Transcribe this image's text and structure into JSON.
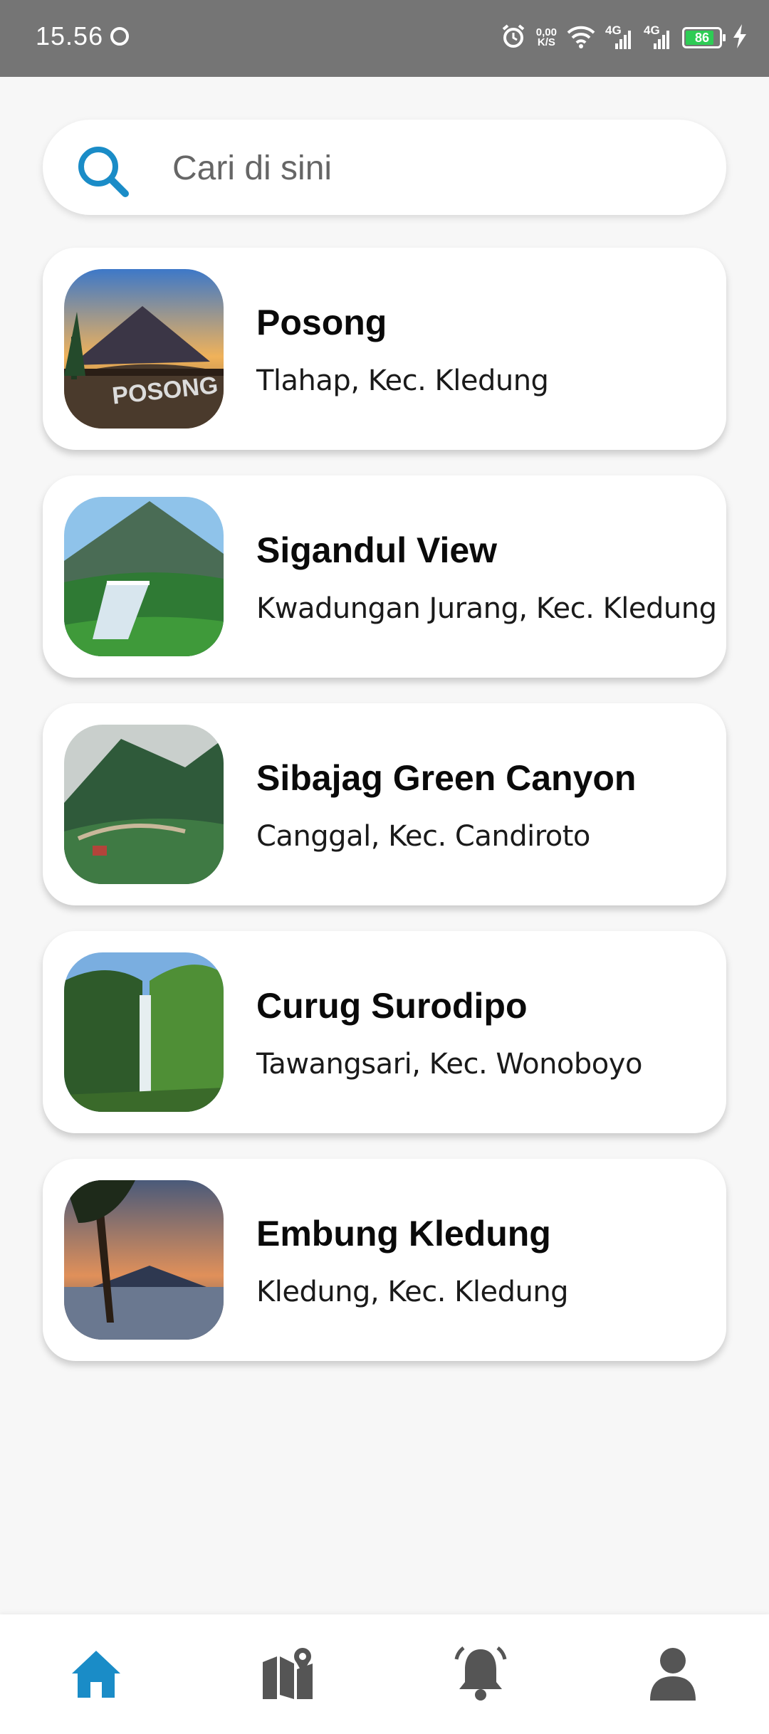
{
  "status_bar": {
    "time": "15.56",
    "net_speed_value": "0,00",
    "net_speed_unit": "K/S",
    "sim1": "4G",
    "sim2": "4G",
    "battery": "86",
    "battery_level": 0.86
  },
  "search": {
    "placeholder": "Cari di sini",
    "value": ""
  },
  "places": [
    {
      "name": "Posong",
      "location": "Tlahap, Kec. Kledung",
      "thumb_label": "POSONG"
    },
    {
      "name": "Sigandul View",
      "location": "Kwadungan Jurang, Kec. Kledung"
    },
    {
      "name": "Sibajag Green Canyon",
      "location": "Canggal, Kec. Candiroto"
    },
    {
      "name": "Curug Surodipo",
      "location": "Tawangsari, Kec. Wonoboyo"
    },
    {
      "name": "Embung Kledung",
      "location": "Kledung, Kec. Kledung"
    }
  ],
  "bottom_nav": {
    "items": [
      {
        "icon": "home-icon",
        "active": true
      },
      {
        "icon": "map-icon",
        "active": false
      },
      {
        "icon": "bell-icon",
        "active": false
      },
      {
        "icon": "user-icon",
        "active": false
      }
    ],
    "active_color": "#1a8cc7",
    "inactive_color": "#555555"
  },
  "colors": {
    "accent": "#1a8cc7",
    "status_bar": "#757575",
    "background": "#f7f7f7",
    "battery_fill": "#2ecc55"
  }
}
